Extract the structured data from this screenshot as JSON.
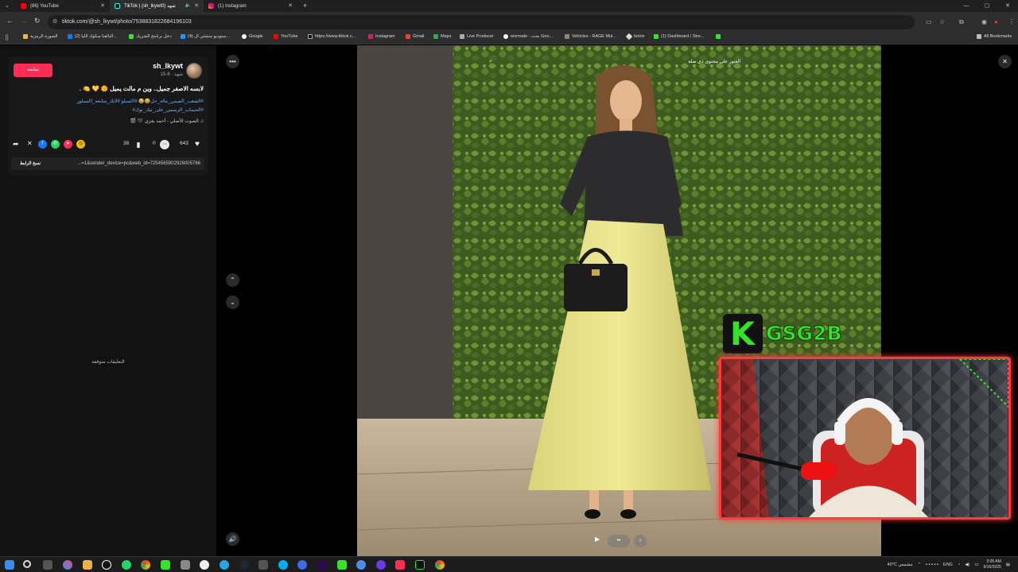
{
  "tabs": [
    {
      "title": "(86) YouTube"
    },
    {
      "title": "TikTok | (sh_lkywt0) شهد"
    },
    {
      "title": "(1) Instagram"
    }
  ],
  "address": {
    "url": "tiktok.com/@sh_lkywt/photo/7538831822684196103"
  },
  "bookmarks": [
    "الصورة الرمزية",
    "(2) البائعنا سكواد الليا...",
    "دخل برنامج الشريك",
    "(4) ستوديو منشئي ال...",
    "Google",
    "YouTube",
    "https://www.tiktok.c...",
    "Instagram",
    "Gmail",
    "Maps",
    "Live Producer",
    "wormate - بحث Goo...",
    "Vehicles - RAGE Mul...",
    "botrix",
    "(1) Dashboard / Stre..."
  ],
  "all_bookmarks": "All Bookmarks",
  "post": {
    "username": "sh_lkywt",
    "meta": "شهد · 8-15",
    "follow_label": "متابعة",
    "caption": "لابسه الاصفر جميل.. وين م مالت يميل 🌼 💛 🍋 .",
    "hashtags_line1": "#الشعب_الصيني_ماله_حل😂😂 #اكسبلو #لايك_متابعه_اكسبلور",
    "hashtags_line2": "#الحساب_الرسمي_على_تيك_توك#",
    "music": "♫ الصوت الأصلي - أحمد يغزي 🖤 🎬",
    "likes": "643",
    "comments": "0",
    "saves": "38",
    "link": "...=1&sender_device=pc&web_id=7254565902926005766",
    "copy_link": "نسخ الرابط",
    "comments_hidden": "التعليقات متوقفة"
  },
  "photo_search": "العثور على محتوى ذي صلة",
  "overlay": {
    "brand": "GSG2B",
    "k": "K"
  },
  "taskbar": {
    "weather": "40°C  مشمس",
    "lang": "ENG",
    "time": "3:05 AM",
    "date": "9/16/2025"
  },
  "colors": {
    "accent_red": "#fe2c55",
    "brand_green": "#35e22c",
    "hashtag_blue": "#7ab3ff"
  }
}
